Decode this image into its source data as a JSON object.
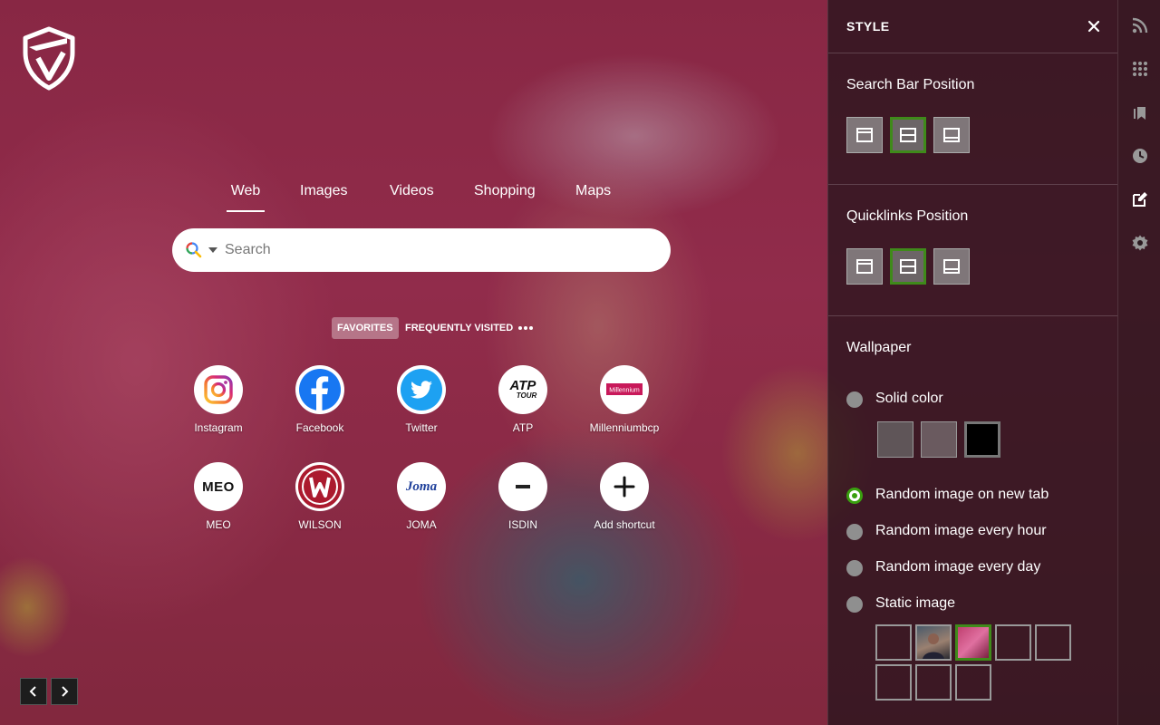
{
  "search": {
    "tabs": [
      {
        "label": "Web",
        "active": true
      },
      {
        "label": "Images",
        "active": false
      },
      {
        "label": "Videos",
        "active": false
      },
      {
        "label": "Shopping",
        "active": false
      },
      {
        "label": "Maps",
        "active": false
      }
    ],
    "placeholder": "Search",
    "engine_icon": "search-icon"
  },
  "quicklinks": {
    "tabs": [
      {
        "label": "FAVORITES",
        "active": true
      },
      {
        "label": "FREQUENTLY VISITED",
        "active": false
      }
    ],
    "more_icon": "more-dots-icon",
    "items": [
      {
        "label": "Instagram",
        "icon": "instagram-icon"
      },
      {
        "label": "Facebook",
        "icon": "facebook-icon"
      },
      {
        "label": "Twitter",
        "icon": "twitter-icon"
      },
      {
        "label": "ATP",
        "icon": "atp-icon",
        "logo_text": [
          "ATP",
          "TOUR"
        ]
      },
      {
        "label": "Millenniumbcp",
        "icon": "millenniumbcp-icon",
        "logo_text": "Millennium"
      },
      {
        "label": "MEO",
        "icon": "meo-icon",
        "logo_text": "MEO"
      },
      {
        "label": "WILSON",
        "icon": "wilson-icon"
      },
      {
        "label": "JOMA",
        "icon": "joma-icon",
        "logo_text": "Joma"
      },
      {
        "label": "ISDIN",
        "icon": "isdin-icon"
      },
      {
        "label": "Add shortcut",
        "icon": "plus-icon"
      }
    ]
  },
  "style_panel": {
    "title": "STYLE",
    "close_icon": "close-icon",
    "search_bar_position": {
      "heading": "Search Bar Position",
      "options": [
        "top",
        "middle",
        "bottom"
      ],
      "selected": "middle"
    },
    "quicklinks_position": {
      "heading": "Quicklinks Position",
      "options": [
        "top",
        "middle",
        "bottom"
      ],
      "selected": "middle"
    },
    "wallpaper": {
      "heading": "Wallpaper",
      "options": [
        {
          "label": "Solid color",
          "selected": false
        },
        {
          "label": "Random image on new tab",
          "selected": true
        },
        {
          "label": "Random image every hour",
          "selected": false
        },
        {
          "label": "Random image every day",
          "selected": false
        },
        {
          "label": "Static image",
          "selected": false
        }
      ],
      "solid_colors": [
        "#5f5558",
        "#6a5a5f",
        "#000000"
      ],
      "static_images_selected_index": 2
    }
  },
  "rail_icons": [
    "rss-icon",
    "apps-grid-icon",
    "bookmarks-icon",
    "history-icon",
    "style-edit-icon",
    "settings-gear-icon"
  ],
  "wallpaper_nav": {
    "prev_icon": "chevron-left-icon",
    "next_icon": "chevron-right-icon"
  },
  "colors": {
    "accent_green": "#3aa00f",
    "panel_bg": "#28141c"
  }
}
